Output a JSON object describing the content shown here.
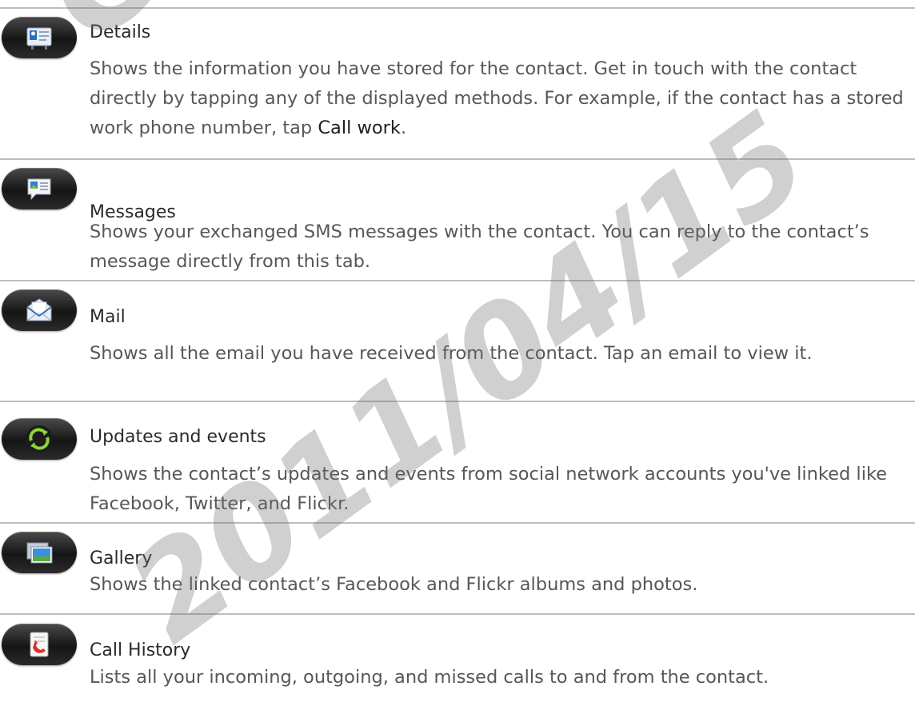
{
  "watermark": {
    "top_text": "Ce",
    "date_text": "2011/04/15"
  },
  "items": [
    {
      "icon": "details-icon",
      "title": "Details",
      "desc_1": "Shows the information you have stored for the contact. Get in touch with the contact directly by tapping any of the displayed methods. For example, if the contact has a stored work phone number, tap ",
      "desc_em": "Call work",
      "desc_2": "."
    },
    {
      "icon": "messages-icon",
      "title": "Messages",
      "desc": "Shows your exchanged SMS messages with the contact. You can reply to the contact’s message directly from this tab."
    },
    {
      "icon": "mail-icon",
      "title": "Mail",
      "desc": "Shows all the email you have received from the contact. Tap an email to view it."
    },
    {
      "icon": "updates-events-icon",
      "title": "Updates and events",
      "desc": "Shows the contact’s updates and events from social network accounts you've linked like Facebook, Twitter, and Flickr."
    },
    {
      "icon": "gallery-icon",
      "title": "Gallery",
      "desc": "Shows the linked contact’s Facebook and Flickr albums and photos."
    },
    {
      "icon": "call-history-icon",
      "title": "Call History",
      "desc": "Lists all your incoming, outgoing, and missed calls to and from the contact."
    }
  ]
}
